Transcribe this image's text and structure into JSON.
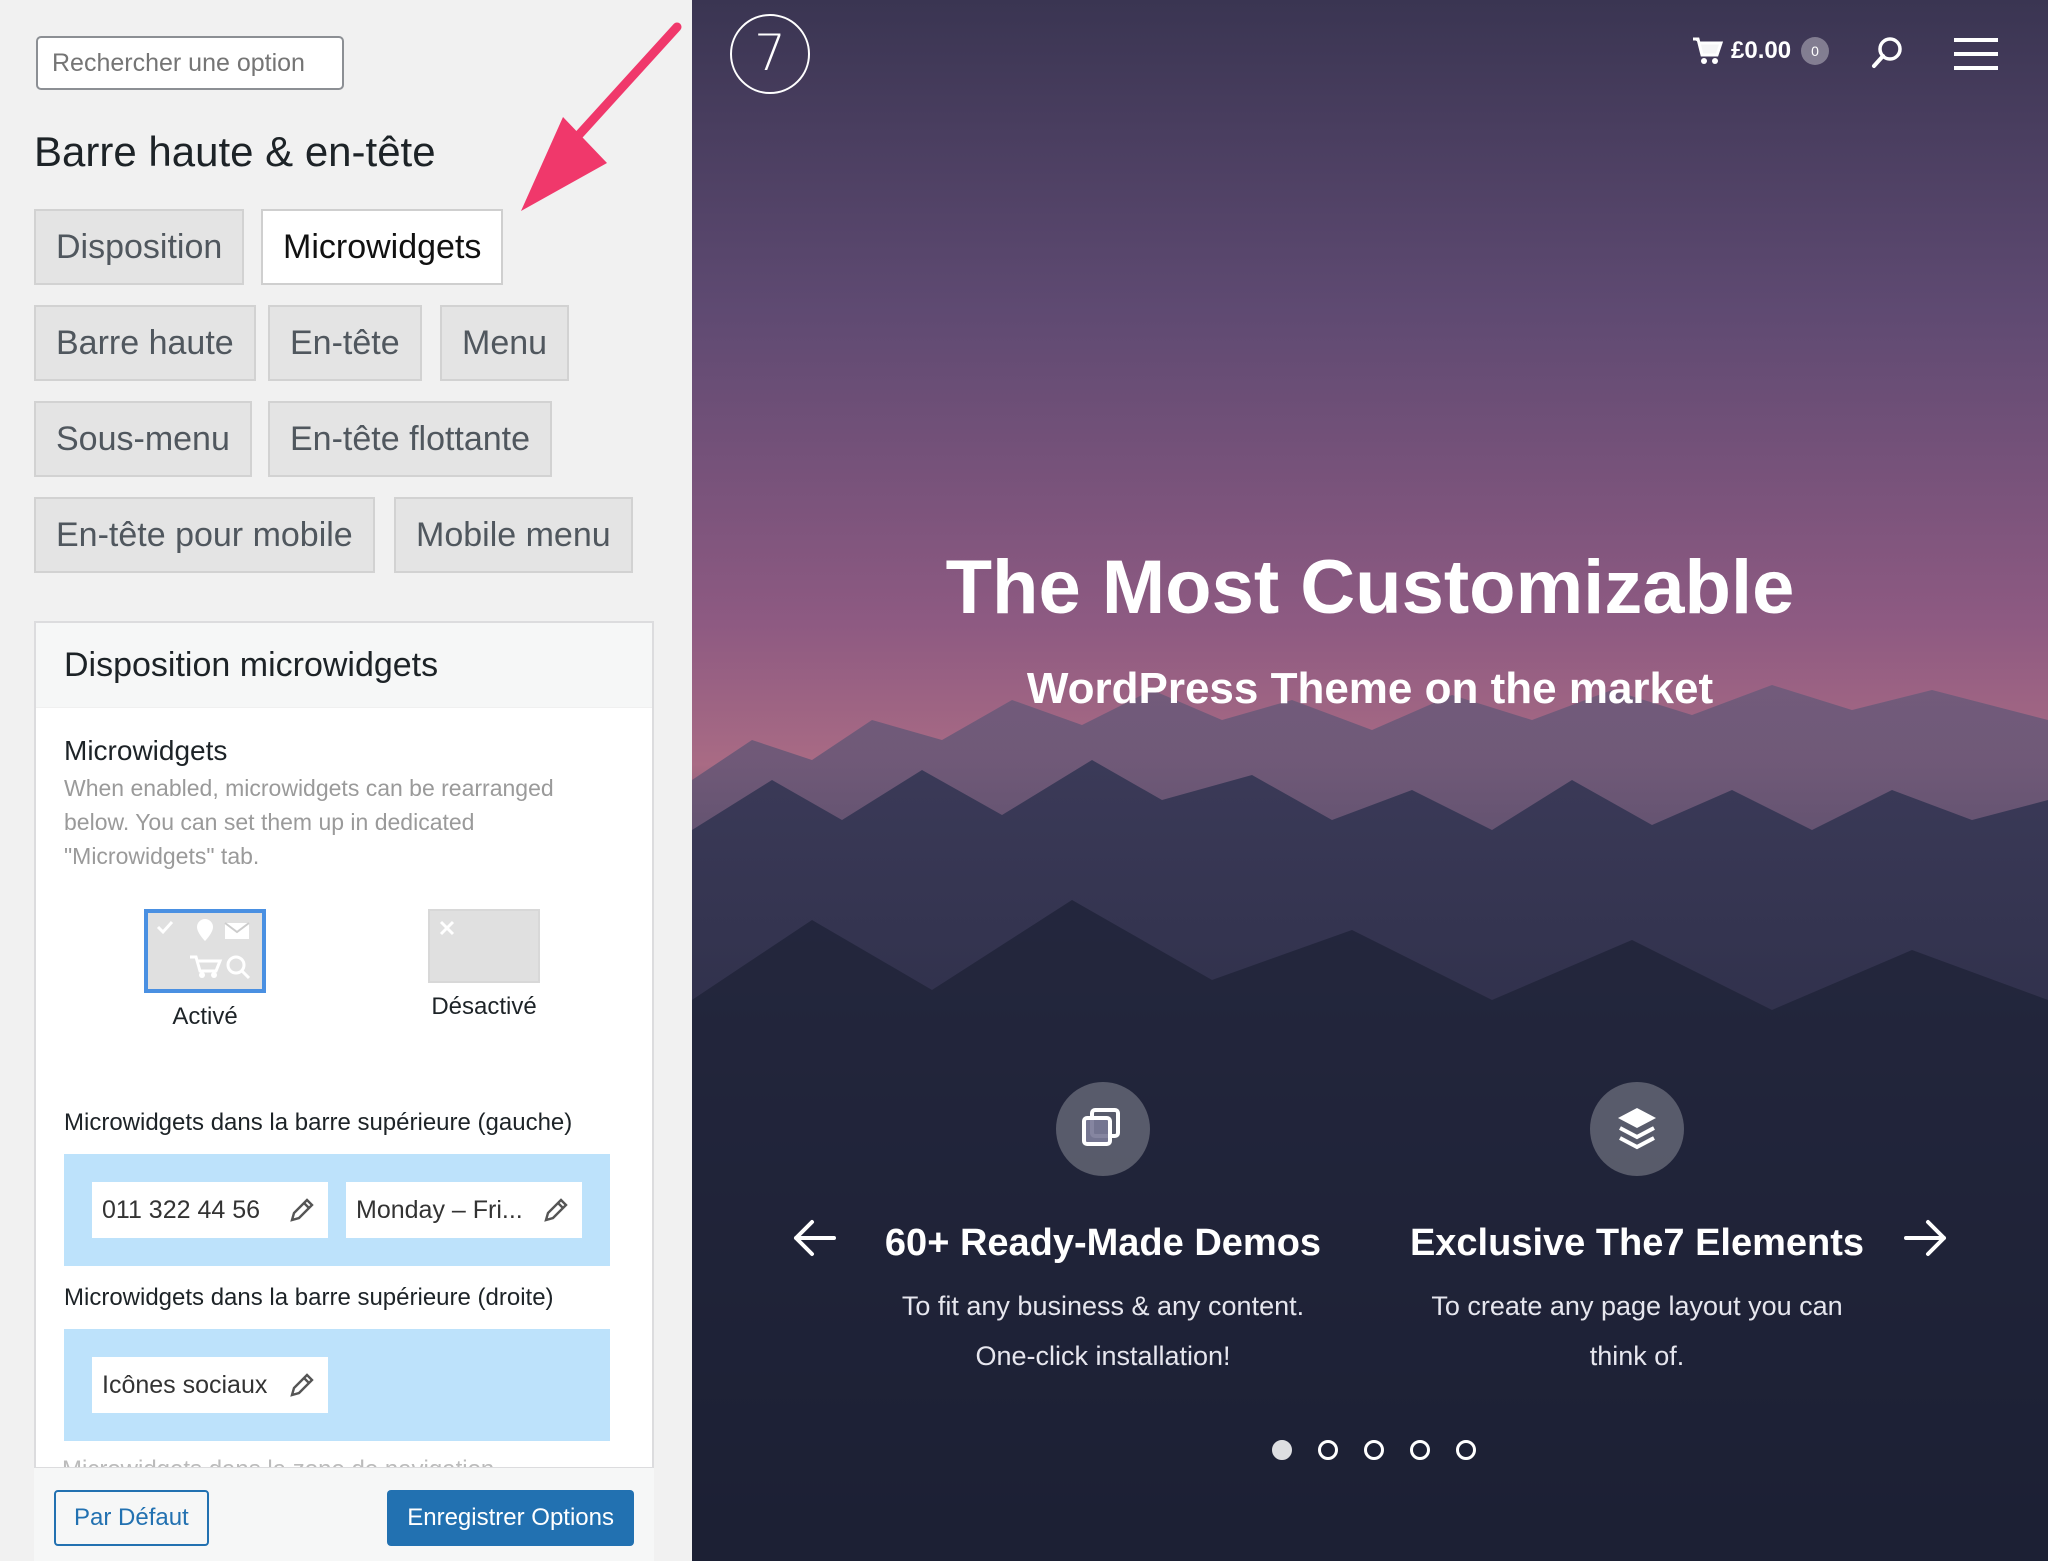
{
  "search": {
    "placeholder": "Rechercher une option"
  },
  "section_title": "Barre haute & en-tête",
  "tabs": [
    {
      "label": "Disposition"
    },
    {
      "label": "Microwidgets",
      "active": true
    },
    {
      "label": "Barre haute"
    },
    {
      "label": "En-tête"
    },
    {
      "label": "Menu"
    },
    {
      "label": "Sous-menu"
    },
    {
      "label": "En-tête flottante"
    },
    {
      "label": "En-tête pour mobile"
    },
    {
      "label": "Mobile menu"
    }
  ],
  "card": {
    "title": "Disposition microwidgets",
    "option_title": "Microwidgets",
    "option_desc": "When enabled, microwidgets can be rearranged below. You can set them up in dedicated \"Microwidgets\" tab.",
    "choices": [
      {
        "label": "Activé",
        "selected": true
      },
      {
        "label": "Désactivé",
        "selected": false
      }
    ],
    "zones": [
      {
        "label": "Microwidgets dans la barre supérieure (gauche)",
        "chips": [
          "011 322 44 56",
          "Monday – Fri..."
        ]
      },
      {
        "label": "Microwidgets dans la barre supérieure (droite)",
        "chips": [
          "Icônes sociaux"
        ]
      }
    ],
    "faded_label": "Microwidgets dans la zone de navigation"
  },
  "footer": {
    "default_label": "Par Défaut",
    "save_label": "Enregistrer Options"
  },
  "preview": {
    "logo": "7",
    "cart_amount": "£0.00",
    "cart_count": "0",
    "hero_title": "The Most Customizable",
    "hero_sub": "WordPress Theme on the market",
    "features": [
      {
        "icon": "windows-icon",
        "title": "60+ Ready-Made Demos",
        "desc": "To fit any business & any content. One-click installation!"
      },
      {
        "icon": "layers-icon",
        "title": "Exclusive The7 Elements",
        "desc": "To create any page layout you can think of."
      }
    ],
    "slides": 5,
    "active_slide": 1
  },
  "colors": {
    "accent": "#2271b1",
    "zone": "#bde2fb",
    "arrow": "#f0386b",
    "selected_border": "#4a90e2"
  }
}
